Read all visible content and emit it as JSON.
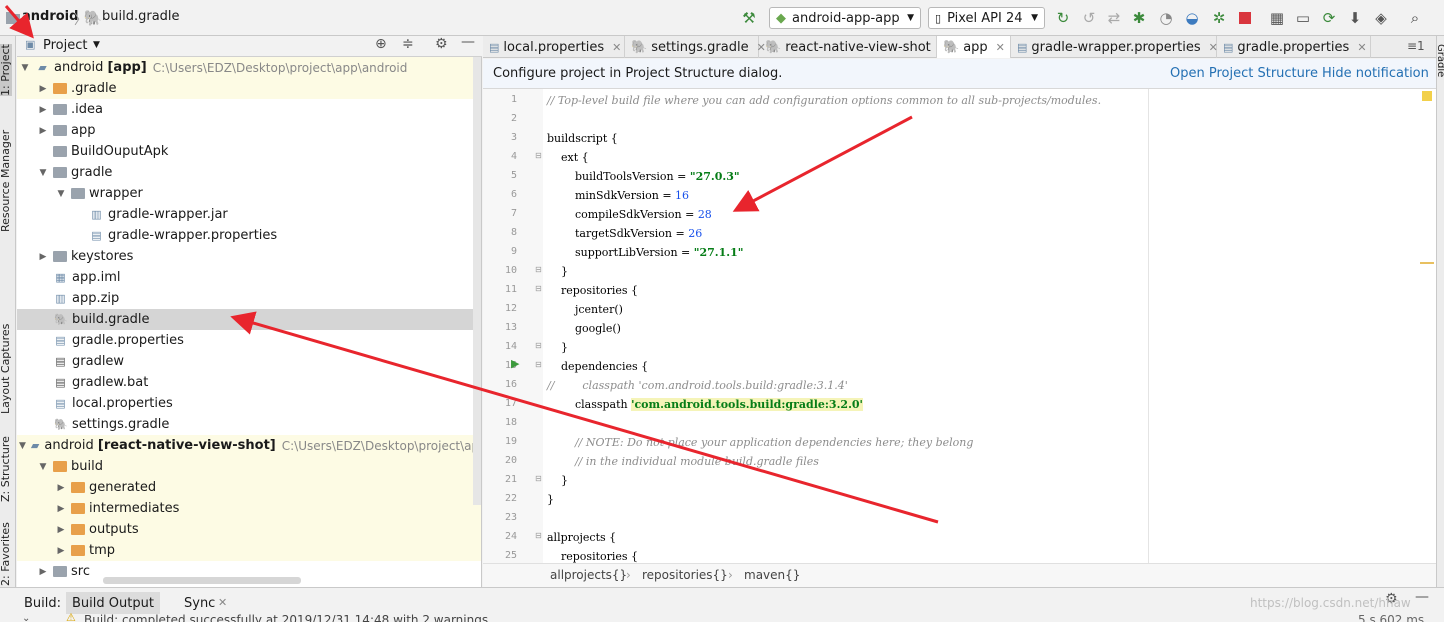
{
  "topbar": {
    "crumb_root": "android",
    "crumb_file": "build.gradle",
    "run_config": "android-app-app",
    "device": "Pixel API 24"
  },
  "stripe": {
    "project": "1: Project",
    "resource_manager": "Resource Manager",
    "layout_captures": "Layout Captures",
    "structure": "Z: Structure",
    "favorites": "2: Favorites"
  },
  "project_pane": {
    "title": "Project",
    "rows": [
      {
        "name": "android",
        "bold_part": "[app]",
        "path": "C:\\Users\\EDZ\\Desktop\\project\\app\\android"
      },
      {
        "name": ".gradle"
      },
      {
        "name": ".idea"
      },
      {
        "name": "app"
      },
      {
        "name": "BuildOuputApk"
      },
      {
        "name": "gradle"
      },
      {
        "name": "wrapper"
      },
      {
        "name": "gradle-wrapper.jar"
      },
      {
        "name": "gradle-wrapper.properties"
      },
      {
        "name": "keystores"
      },
      {
        "name": "app.iml"
      },
      {
        "name": "app.zip"
      },
      {
        "name": "build.gradle"
      },
      {
        "name": "gradle.properties"
      },
      {
        "name": "gradlew"
      },
      {
        "name": "gradlew.bat"
      },
      {
        "name": "local.properties"
      },
      {
        "name": "settings.gradle"
      },
      {
        "name": "android",
        "bold_part": "[react-native-view-shot]",
        "path": "C:\\Users\\EDZ\\Desktop\\project\\app\\nc"
      },
      {
        "name": "build"
      },
      {
        "name": "generated"
      },
      {
        "name": "intermediates"
      },
      {
        "name": "outputs"
      },
      {
        "name": "tmp"
      },
      {
        "name": "src"
      }
    ]
  },
  "tabs": [
    "local.properties",
    "settings.gradle",
    "react-native-view-shot",
    "app",
    "gradle-wrapper.properties",
    "gradle.properties"
  ],
  "notification": {
    "text": "Configure project in Project Structure dialog.",
    "open_link": "Open Project Structure",
    "hide_link": "Hide notification"
  },
  "code": {
    "l1": "// Top-level build file where you can add configuration options common to all sub-projects/modules.",
    "l3": "buildscript {",
    "l4": "    ext {",
    "l5a": "        buildToolsVersion = ",
    "l5b": "\"27.0.3\"",
    "l6a": "        minSdkVersion = ",
    "l6b": "16",
    "l7a": "        compileSdkVersion = ",
    "l7b": "28",
    "l8a": "        targetSdkVersion = ",
    "l8b": "26",
    "l9a": "        supportLibVersion = ",
    "l9b": "\"27.1.1\"",
    "l10": "    }",
    "l11": "    repositories {",
    "l12": "        jcenter()",
    "l13": "        google()",
    "l14": "    }",
    "l15": "    dependencies {",
    "l16": "//        classpath 'com.android.tools.build:gradle:3.1.4'",
    "l17a": "        classpath ",
    "l17b": "'com.android.tools.build:gradle:3.2.0'",
    "l19": "        // NOTE: Do not place your application dependencies here; they belong",
    "l20": "        // in the individual module build.gradle files",
    "l21": "    }",
    "l22": "}",
    "l24": "allprojects {",
    "l25": "    repositories {"
  },
  "breadcrumbs": [
    "allprojects{}",
    "repositories{}",
    "maven{}"
  ],
  "bottom": {
    "build_label": "Build:",
    "build_output": "Build Output",
    "sync": "Sync",
    "status": "Build: completed successfully at 2019/12/31 14:48  with 2 warnings",
    "right_text": "5 s 602 ms",
    "watermark": "https://blog.csdn.net/hhaw"
  },
  "right_stripe": "Gradle"
}
